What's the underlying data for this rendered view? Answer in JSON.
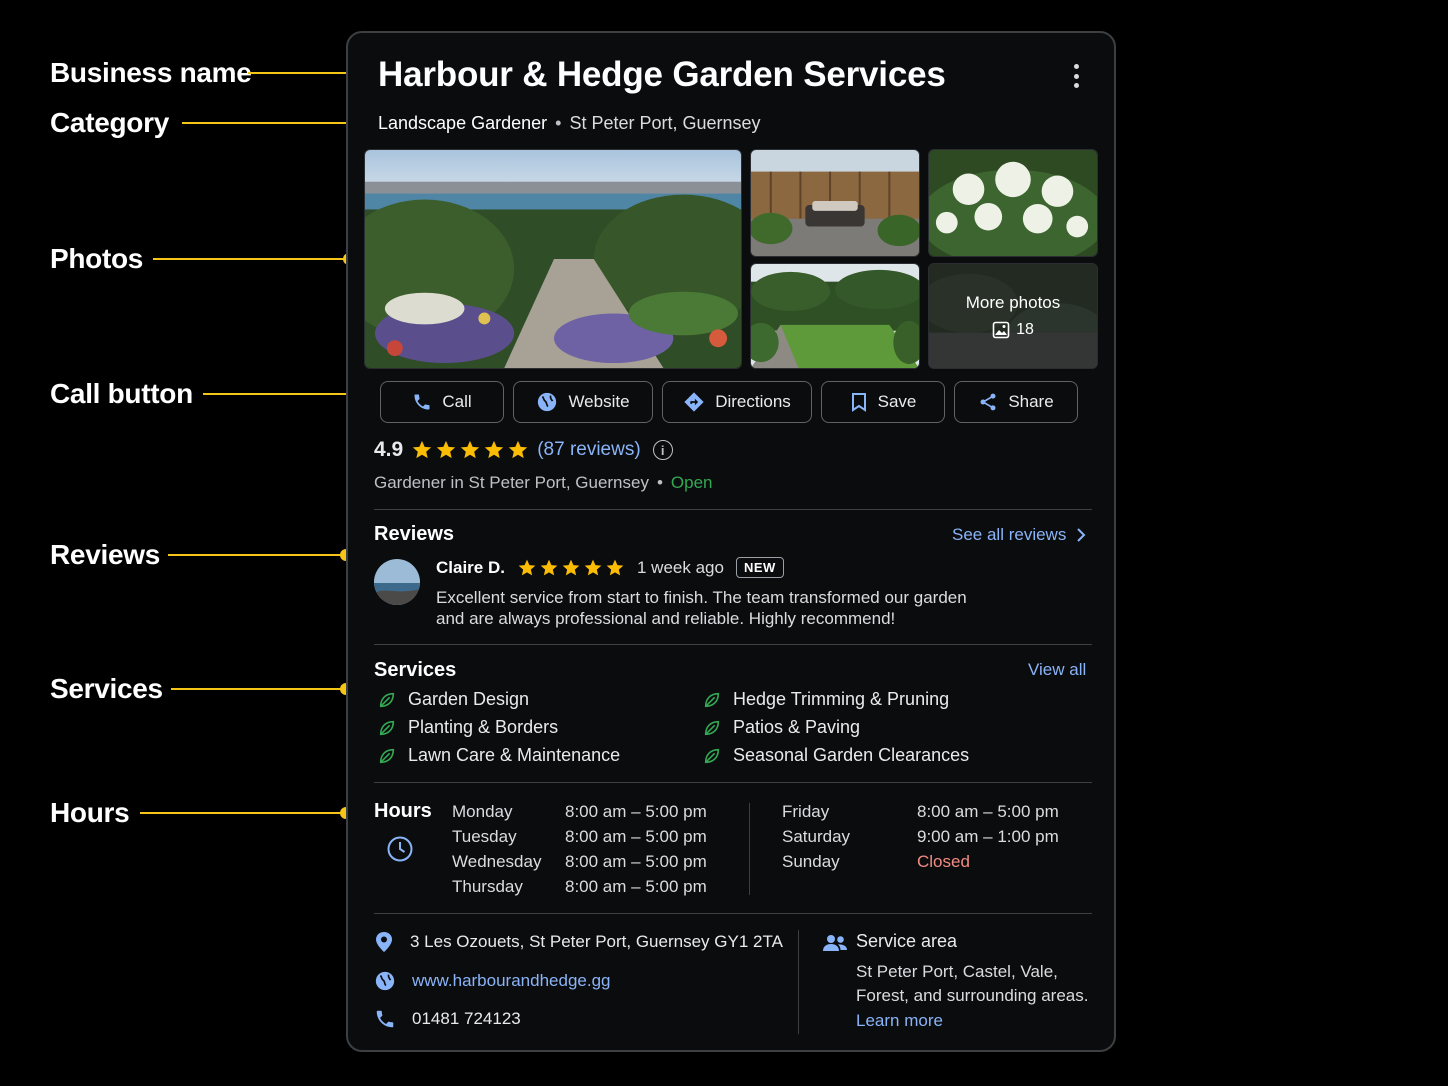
{
  "annotations": [
    {
      "label": "Business name"
    },
    {
      "label": "Category"
    },
    {
      "label": "Photos"
    },
    {
      "label": "Call button"
    },
    {
      "label": "Reviews"
    },
    {
      "label": "Services"
    },
    {
      "label": "Hours"
    }
  ],
  "business": {
    "name": "Harbour & Hedge Garden Services",
    "category": "Landscape Gardener",
    "location": "St Peter Port, Guernsey"
  },
  "photos": {
    "more_label": "More photos",
    "count": "18"
  },
  "actions": {
    "call": "Call",
    "website": "Website",
    "directions": "Directions",
    "save": "Save",
    "share": "Share"
  },
  "rating": {
    "value": "4.9",
    "stars": 5,
    "reviews_label": "(87 reviews)",
    "category_line": "Gardener in St Peter Port, Guernsey",
    "status": "Open"
  },
  "reviews": {
    "heading": "Reviews",
    "see_all": "See all reviews",
    "item": {
      "author": "Claire D.",
      "stars": 5,
      "time": "1 week ago",
      "badge": "NEW",
      "text": "Excellent service from start to finish. The team transformed our garden and are always professional and reliable. Highly recommend!"
    }
  },
  "services": {
    "heading": "Services",
    "view_all": "View all",
    "items": [
      "Garden Design",
      "Hedge Trimming & Pruning",
      "Planting & Borders",
      "Patios & Paving",
      "Lawn Care & Maintenance",
      "Seasonal Garden Clearances"
    ]
  },
  "hours": {
    "heading": "Hours",
    "days": [
      {
        "day": "Monday",
        "time": "8:00 am – 5:00 pm"
      },
      {
        "day": "Tuesday",
        "time": "8:00 am – 5:00 pm"
      },
      {
        "day": "Wednesday",
        "time": "8:00 am – 5:00 pm"
      },
      {
        "day": "Thursday",
        "time": "8:00 am – 5:00 pm"
      },
      {
        "day": "Friday",
        "time": "8:00 am – 5:00 pm"
      },
      {
        "day": "Saturday",
        "time": "9:00 am – 1:00 pm"
      },
      {
        "day": "Sunday",
        "time": "Closed"
      }
    ]
  },
  "contact": {
    "address": "3 Les Ozouets, St Peter Port, Guernsey GY1 2TA",
    "website": "www.harbourandhedge.gg",
    "phone": "01481 724123"
  },
  "service_area": {
    "heading": "Service area",
    "text": "St Peter Port, Castel, Vale, Forest, and surrounding areas.",
    "learn_more": "Learn more"
  },
  "colors": {
    "accent_yellow": "#f5c518",
    "link_blue": "#8ab4f8",
    "open_green": "#34a853",
    "closed_red": "#f28b82",
    "star": "#fbbc04"
  }
}
